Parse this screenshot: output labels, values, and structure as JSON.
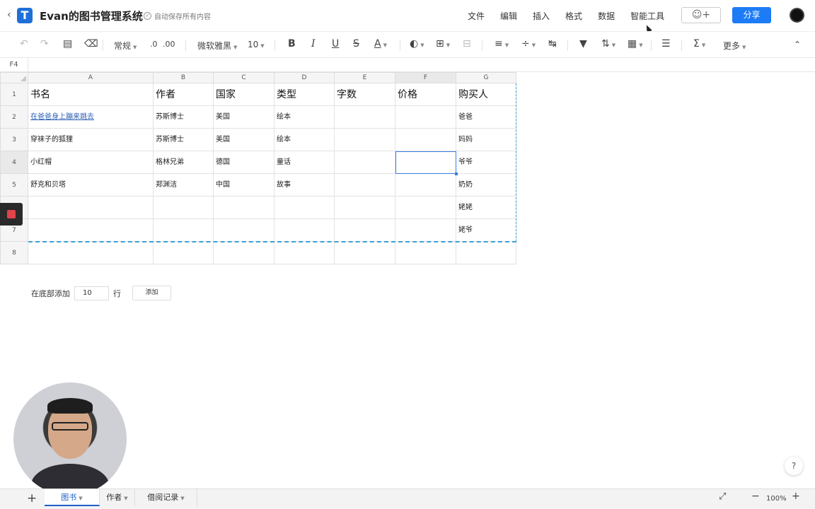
{
  "header": {
    "back_icon": "chevron-left-icon",
    "logo_letter": "T",
    "title": "Evan的图书管理系统",
    "autosave": "自动保存所有内容",
    "menu": [
      "文件",
      "编辑",
      "插入",
      "格式",
      "数据",
      "智能工具"
    ],
    "share": "分享",
    "accent": "#1d7bf5"
  },
  "toolbar": {
    "number_format": "常规",
    "decrease_decimal": ".0",
    "increase_decimal": ".00",
    "font": "微软雅黑",
    "font_size": "10",
    "bold": "B",
    "italic": "I",
    "underline": "U",
    "strikethrough": "S",
    "font_color": "A",
    "sum": "Σ",
    "more": "更多"
  },
  "formula_bar": {
    "cell_ref": "F4"
  },
  "sheet": {
    "columns": [
      "A",
      "B",
      "C",
      "D",
      "E",
      "F",
      "G"
    ],
    "selected_column": "F",
    "rows": [
      "1",
      "2",
      "3",
      "4",
      "5",
      "6",
      "7",
      "8"
    ],
    "selected_row": "4",
    "header_row": [
      "书名",
      "作者",
      "国家",
      "类型",
      "字数",
      "价格",
      "购买人"
    ],
    "data": [
      [
        "在爸爸身上蹦来跳去",
        "苏斯博士",
        "美国",
        "绘本",
        "",
        "",
        "爸爸"
      ],
      [
        "穿袜子的狐狸",
        "苏斯博士",
        "美国",
        "绘本",
        "",
        "",
        "妈妈"
      ],
      [
        "小红帽",
        "格林兄弟",
        "德国",
        "童话",
        "",
        "",
        "爷爷"
      ],
      [
        "舒克和贝塔",
        "郑渊洁",
        "中国",
        "故事",
        "",
        "",
        "奶奶"
      ],
      [
        "",
        "",
        "",
        "",
        "",
        "",
        "姥姥"
      ],
      [
        "",
        "",
        "",
        "",
        "",
        "",
        "姥爷"
      ],
      [
        "",
        "",
        "",
        "",
        "",
        "",
        ""
      ]
    ]
  },
  "add_rows": {
    "prefix": "在底部添加",
    "count": "10",
    "suffix": "行",
    "button": "添加"
  },
  "help": "?",
  "sheet_tabs": [
    "图书",
    "作者",
    "借阅记录"
  ],
  "active_tab": "图书",
  "zoom": "100%"
}
